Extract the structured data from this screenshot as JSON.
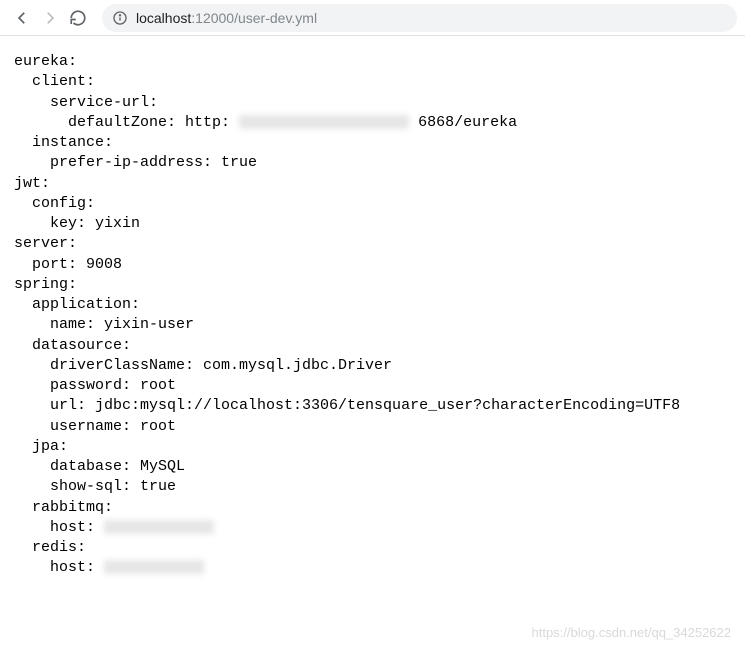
{
  "address": {
    "host": "localhost",
    "rest": ":12000/user-dev.yml"
  },
  "yaml": {
    "l1": "eureka:",
    "l2": "  client:",
    "l3": "    service-url:",
    "l4a": "      defaultZone: http:",
    "l4b": "6868/eureka",
    "l5": "  instance:",
    "l6": "    prefer-ip-address: true",
    "l7": "jwt:",
    "l8": "  config:",
    "l9": "    key: yixin",
    "l10": "server:",
    "l11": "  port: 9008",
    "l12": "spring:",
    "l13": "  application:",
    "l14": "    name: yixin-user",
    "l15": "  datasource:",
    "l16": "    driverClassName: com.mysql.jdbc.Driver",
    "l17": "    password: root",
    "l18": "    url: jdbc:mysql://localhost:3306/tensquare_user?characterEncoding=UTF8",
    "l19": "    username: root",
    "l20": "  jpa:",
    "l21": "    database: MySQL",
    "l22": "    show-sql: true",
    "l23": "  rabbitmq:",
    "l24": "    host:",
    "l25": "  redis:",
    "l26": "    host:"
  },
  "watermark": "https://blog.csdn.net/qq_34252622"
}
